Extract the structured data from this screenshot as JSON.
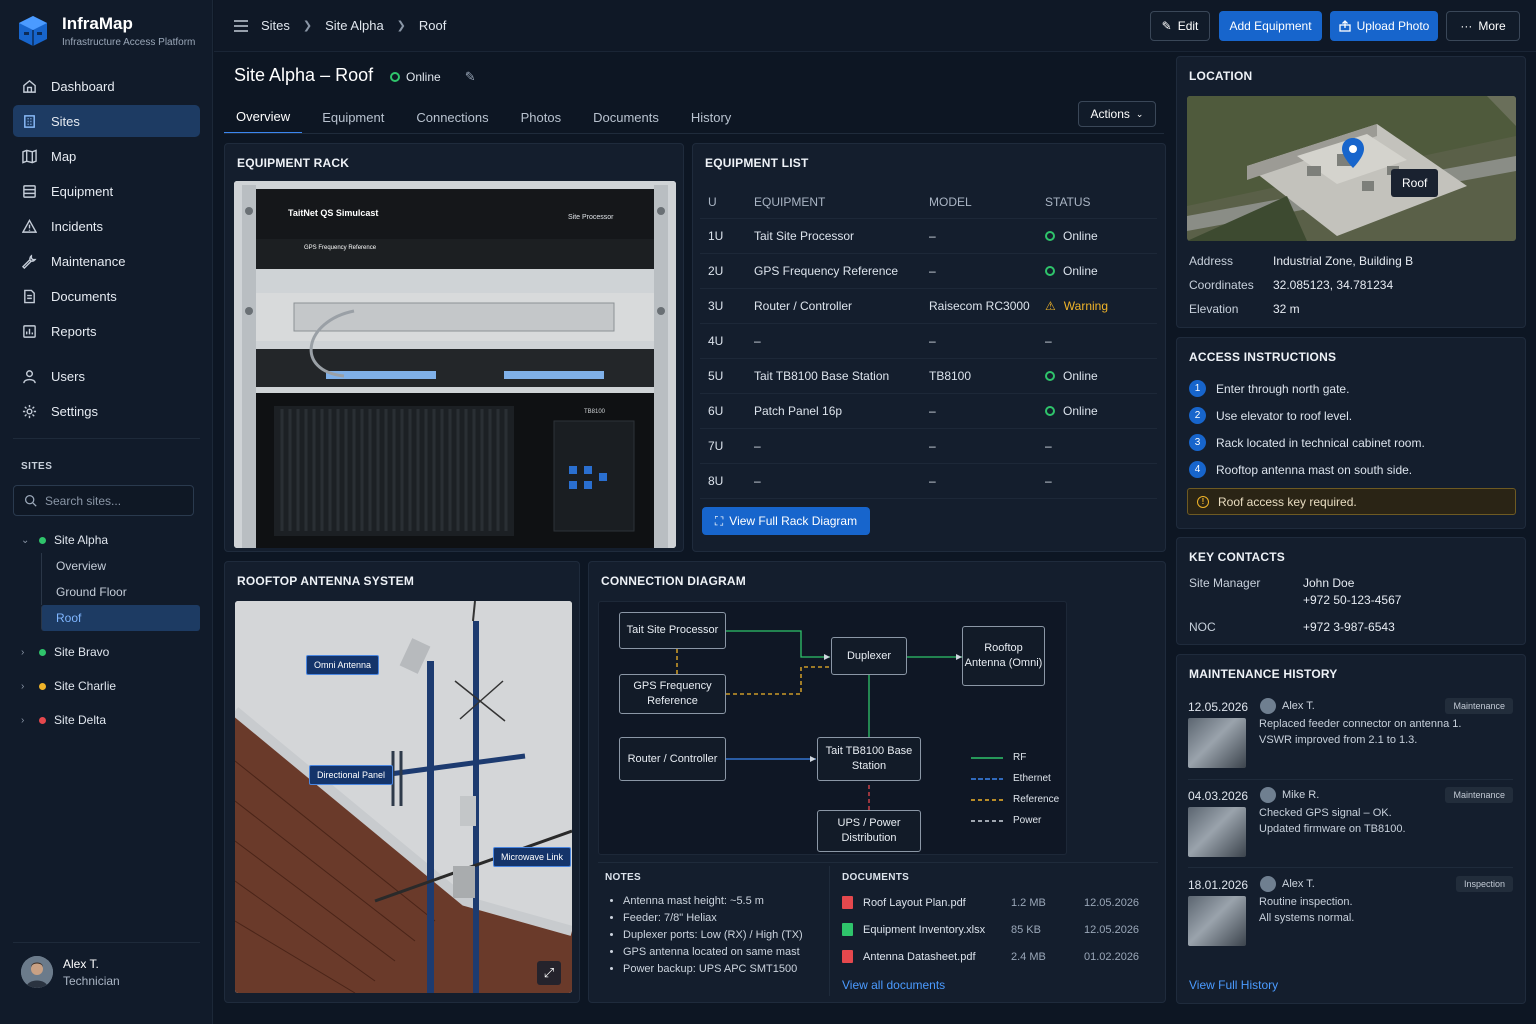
{
  "app": {
    "name": "InfraMap",
    "subtitle": "Infrastructure Access Platform"
  },
  "nav": [
    {
      "label": "Dashboard",
      "icon": "home-icon"
    },
    {
      "label": "Sites",
      "icon": "building-icon",
      "active": true
    },
    {
      "label": "Map",
      "icon": "map-icon"
    },
    {
      "label": "Equipment",
      "icon": "server-icon"
    },
    {
      "label": "Incidents",
      "icon": "alert-triangle-icon"
    },
    {
      "label": "Maintenance",
      "icon": "wrench-icon"
    },
    {
      "label": "Documents",
      "icon": "document-icon"
    },
    {
      "label": "Reports",
      "icon": "chart-icon"
    },
    {
      "label": "Users",
      "icon": "user-icon"
    },
    {
      "label": "Settings",
      "icon": "gear-icon"
    }
  ],
  "sites_panel": {
    "label": "SITES",
    "search_placeholder": "Search sites...",
    "sites": [
      {
        "name": "Site Alpha",
        "color": "#2fc46b",
        "expanded": true,
        "children": [
          "Overview",
          "Ground Floor",
          "Roof"
        ],
        "active_child": "Roof"
      },
      {
        "name": "Site Bravo",
        "color": "#2fc46b"
      },
      {
        "name": "Site Charlie",
        "color": "#f0b429"
      },
      {
        "name": "Site Delta",
        "color": "#e5484d"
      }
    ]
  },
  "user": {
    "name": "Alex T.",
    "role": "Technician"
  },
  "breadcrumb": [
    "Sites",
    "Site Alpha",
    "Roof"
  ],
  "toolbar": {
    "edit": "Edit",
    "add_equipment": "Add Equipment",
    "upload_photo": "Upload Photo",
    "more": "More"
  },
  "page": {
    "title": "Site Alpha – Roof",
    "status": "Online"
  },
  "tabs": [
    "Overview",
    "Equipment",
    "Connections",
    "Photos",
    "Documents",
    "History"
  ],
  "actions_label": "Actions",
  "rack": {
    "title": "EQUIPMENT RACK",
    "brand_line": "TaitNet QS Simulcast",
    "processor_label": "Site Processor",
    "gps_label": "GPS Frequency Reference",
    "tb_label": "TB8100"
  },
  "equipment_list": {
    "title": "EQUIPMENT LIST",
    "columns": [
      "U",
      "EQUIPMENT",
      "MODEL",
      "STATUS"
    ],
    "rows": [
      {
        "u": "1U",
        "equipment": "Tait Site Processor",
        "model": "–",
        "status": "Online"
      },
      {
        "u": "2U",
        "equipment": "GPS Frequency Reference",
        "model": "–",
        "status": "Online"
      },
      {
        "u": "3U",
        "equipment": "Router / Controller",
        "model": "Raisecom RC3000",
        "status": "Warning"
      },
      {
        "u": "4U",
        "equipment": "–",
        "model": "–",
        "status": "–"
      },
      {
        "u": "5U",
        "equipment": "Tait TB8100 Base Station",
        "model": "TB8100",
        "status": "Online"
      },
      {
        "u": "6U",
        "equipment": "Patch Panel 16p",
        "model": "–",
        "status": "Online"
      },
      {
        "u": "7U",
        "equipment": "–",
        "model": "–",
        "status": "–"
      },
      {
        "u": "8U",
        "equipment": "–",
        "model": "–",
        "status": "–"
      }
    ],
    "button": "View Full Rack Diagram"
  },
  "antenna": {
    "title": "ROOFTOP ANTENNA SYSTEM",
    "labels": [
      "Omni Antenna",
      "Directional Panel",
      "Microwave Link"
    ]
  },
  "diagram": {
    "title": "CONNECTION DIAGRAM",
    "nodes": {
      "processor": "Tait Site Processor",
      "gps": "GPS Frequency Reference",
      "router": "Router / Controller",
      "duplexer": "Duplexer",
      "antenna": "Rooftop Antenna (Omni)",
      "base": "Tait TB8100 Base Station",
      "ups": "UPS / Power Distribution"
    },
    "legend": [
      "RF",
      "Ethernet",
      "Reference",
      "Power"
    ],
    "colors": {
      "rf": "#2fc46b",
      "ethernet": "#3b86f0",
      "reference": "#f0b429",
      "power": "#e5484d"
    }
  },
  "notes": {
    "title": "NOTES",
    "items": [
      "Antenna mast height: ~5.5 m",
      "Feeder: 7/8\" Heliax",
      "Duplexer ports: Low (RX) / High (TX)",
      "GPS antenna located on same mast",
      "Power backup: UPS APC SMT1500"
    ]
  },
  "documents": {
    "title": "DOCUMENTS",
    "items": [
      {
        "name": "Roof Layout Plan.pdf",
        "size": "1.2 MB",
        "date": "12.05.2026",
        "icon": "pdf-icon"
      },
      {
        "name": "Equipment Inventory.xlsx",
        "size": "85 KB",
        "date": "12.05.2026",
        "icon": "xlsx-icon"
      },
      {
        "name": "Antenna Datasheet.pdf",
        "size": "2.4 MB",
        "date": "01.02.2026",
        "icon": "pdf-icon"
      }
    ],
    "link": "View all documents"
  },
  "location": {
    "title": "LOCATION",
    "map_label": "Roof",
    "address_label": "Address",
    "address": "Industrial Zone, Building B",
    "coords_label": "Coordinates",
    "coords": "32.085123, 34.781234",
    "elevation_label": "Elevation",
    "elevation": "32 m"
  },
  "access": {
    "title": "ACCESS INSTRUCTIONS",
    "steps": [
      "Enter through north gate.",
      "Use elevator to roof level.",
      "Rack located in technical cabinet room.",
      "Rooftop antenna mast on south side."
    ],
    "notice": "Roof access key required."
  },
  "contacts": {
    "title": "KEY CONTACTS",
    "manager_label": "Site Manager",
    "manager_name": "John Doe",
    "manager_phone": "+972 50-123-4567",
    "noc_label": "NOC",
    "noc_phone": "+972 3-987-6543"
  },
  "maintenance": {
    "title": "MAINTENANCE HISTORY",
    "entries": [
      {
        "date": "12.05.2026",
        "by": "Alex T.",
        "type": "Maintenance",
        "line1": "Replaced feeder connector on antenna 1.",
        "line2": "VSWR improved from 2.1 to 1.3."
      },
      {
        "date": "04.03.2026",
        "by": "Mike R.",
        "type": "Maintenance",
        "line1": "Checked GPS signal – OK.",
        "line2": "Updated firmware on TB8100."
      },
      {
        "date": "18.01.2026",
        "by": "Alex T.",
        "type": "Inspection",
        "line1": "Routine inspection.",
        "line2": "All systems normal."
      }
    ],
    "link": "View Full History"
  }
}
